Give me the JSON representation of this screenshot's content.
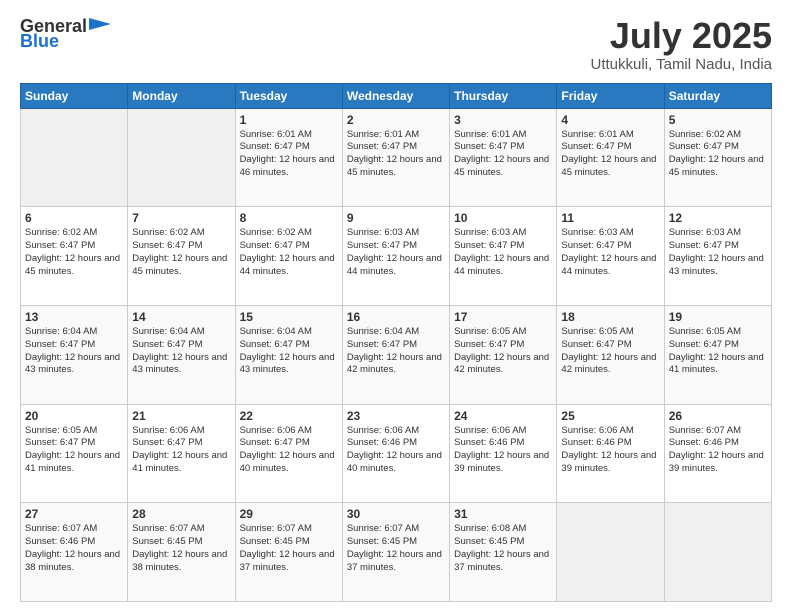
{
  "header": {
    "logo_general": "General",
    "logo_blue": "Blue",
    "month": "July 2025",
    "location": "Uttukkuli, Tamil Nadu, India"
  },
  "weekdays": [
    "Sunday",
    "Monday",
    "Tuesday",
    "Wednesday",
    "Thursday",
    "Friday",
    "Saturday"
  ],
  "weeks": [
    [
      {
        "day": "",
        "sunrise": "",
        "sunset": "",
        "daylight": "",
        "empty": true
      },
      {
        "day": "",
        "sunrise": "",
        "sunset": "",
        "daylight": "",
        "empty": true
      },
      {
        "day": "1",
        "sunrise": "Sunrise: 6:01 AM",
        "sunset": "Sunset: 6:47 PM",
        "daylight": "Daylight: 12 hours and 46 minutes."
      },
      {
        "day": "2",
        "sunrise": "Sunrise: 6:01 AM",
        "sunset": "Sunset: 6:47 PM",
        "daylight": "Daylight: 12 hours and 45 minutes."
      },
      {
        "day": "3",
        "sunrise": "Sunrise: 6:01 AM",
        "sunset": "Sunset: 6:47 PM",
        "daylight": "Daylight: 12 hours and 45 minutes."
      },
      {
        "day": "4",
        "sunrise": "Sunrise: 6:01 AM",
        "sunset": "Sunset: 6:47 PM",
        "daylight": "Daylight: 12 hours and 45 minutes."
      },
      {
        "day": "5",
        "sunrise": "Sunrise: 6:02 AM",
        "sunset": "Sunset: 6:47 PM",
        "daylight": "Daylight: 12 hours and 45 minutes."
      }
    ],
    [
      {
        "day": "6",
        "sunrise": "Sunrise: 6:02 AM",
        "sunset": "Sunset: 6:47 PM",
        "daylight": "Daylight: 12 hours and 45 minutes."
      },
      {
        "day": "7",
        "sunrise": "Sunrise: 6:02 AM",
        "sunset": "Sunset: 6:47 PM",
        "daylight": "Daylight: 12 hours and 45 minutes."
      },
      {
        "day": "8",
        "sunrise": "Sunrise: 6:02 AM",
        "sunset": "Sunset: 6:47 PM",
        "daylight": "Daylight: 12 hours and 44 minutes."
      },
      {
        "day": "9",
        "sunrise": "Sunrise: 6:03 AM",
        "sunset": "Sunset: 6:47 PM",
        "daylight": "Daylight: 12 hours and 44 minutes."
      },
      {
        "day": "10",
        "sunrise": "Sunrise: 6:03 AM",
        "sunset": "Sunset: 6:47 PM",
        "daylight": "Daylight: 12 hours and 44 minutes."
      },
      {
        "day": "11",
        "sunrise": "Sunrise: 6:03 AM",
        "sunset": "Sunset: 6:47 PM",
        "daylight": "Daylight: 12 hours and 44 minutes."
      },
      {
        "day": "12",
        "sunrise": "Sunrise: 6:03 AM",
        "sunset": "Sunset: 6:47 PM",
        "daylight": "Daylight: 12 hours and 43 minutes."
      }
    ],
    [
      {
        "day": "13",
        "sunrise": "Sunrise: 6:04 AM",
        "sunset": "Sunset: 6:47 PM",
        "daylight": "Daylight: 12 hours and 43 minutes."
      },
      {
        "day": "14",
        "sunrise": "Sunrise: 6:04 AM",
        "sunset": "Sunset: 6:47 PM",
        "daylight": "Daylight: 12 hours and 43 minutes."
      },
      {
        "day": "15",
        "sunrise": "Sunrise: 6:04 AM",
        "sunset": "Sunset: 6:47 PM",
        "daylight": "Daylight: 12 hours and 43 minutes."
      },
      {
        "day": "16",
        "sunrise": "Sunrise: 6:04 AM",
        "sunset": "Sunset: 6:47 PM",
        "daylight": "Daylight: 12 hours and 42 minutes."
      },
      {
        "day": "17",
        "sunrise": "Sunrise: 6:05 AM",
        "sunset": "Sunset: 6:47 PM",
        "daylight": "Daylight: 12 hours and 42 minutes."
      },
      {
        "day": "18",
        "sunrise": "Sunrise: 6:05 AM",
        "sunset": "Sunset: 6:47 PM",
        "daylight": "Daylight: 12 hours and 42 minutes."
      },
      {
        "day": "19",
        "sunrise": "Sunrise: 6:05 AM",
        "sunset": "Sunset: 6:47 PM",
        "daylight": "Daylight: 12 hours and 41 minutes."
      }
    ],
    [
      {
        "day": "20",
        "sunrise": "Sunrise: 6:05 AM",
        "sunset": "Sunset: 6:47 PM",
        "daylight": "Daylight: 12 hours and 41 minutes."
      },
      {
        "day": "21",
        "sunrise": "Sunrise: 6:06 AM",
        "sunset": "Sunset: 6:47 PM",
        "daylight": "Daylight: 12 hours and 41 minutes."
      },
      {
        "day": "22",
        "sunrise": "Sunrise: 6:06 AM",
        "sunset": "Sunset: 6:47 PM",
        "daylight": "Daylight: 12 hours and 40 minutes."
      },
      {
        "day": "23",
        "sunrise": "Sunrise: 6:06 AM",
        "sunset": "Sunset: 6:46 PM",
        "daylight": "Daylight: 12 hours and 40 minutes."
      },
      {
        "day": "24",
        "sunrise": "Sunrise: 6:06 AM",
        "sunset": "Sunset: 6:46 PM",
        "daylight": "Daylight: 12 hours and 39 minutes."
      },
      {
        "day": "25",
        "sunrise": "Sunrise: 6:06 AM",
        "sunset": "Sunset: 6:46 PM",
        "daylight": "Daylight: 12 hours and 39 minutes."
      },
      {
        "day": "26",
        "sunrise": "Sunrise: 6:07 AM",
        "sunset": "Sunset: 6:46 PM",
        "daylight": "Daylight: 12 hours and 39 minutes."
      }
    ],
    [
      {
        "day": "27",
        "sunrise": "Sunrise: 6:07 AM",
        "sunset": "Sunset: 6:46 PM",
        "daylight": "Daylight: 12 hours and 38 minutes."
      },
      {
        "day": "28",
        "sunrise": "Sunrise: 6:07 AM",
        "sunset": "Sunset: 6:45 PM",
        "daylight": "Daylight: 12 hours and 38 minutes."
      },
      {
        "day": "29",
        "sunrise": "Sunrise: 6:07 AM",
        "sunset": "Sunset: 6:45 PM",
        "daylight": "Daylight: 12 hours and 37 minutes."
      },
      {
        "day": "30",
        "sunrise": "Sunrise: 6:07 AM",
        "sunset": "Sunset: 6:45 PM",
        "daylight": "Daylight: 12 hours and 37 minutes."
      },
      {
        "day": "31",
        "sunrise": "Sunrise: 6:08 AM",
        "sunset": "Sunset: 6:45 PM",
        "daylight": "Daylight: 12 hours and 37 minutes."
      },
      {
        "day": "",
        "sunrise": "",
        "sunset": "",
        "daylight": "",
        "empty": true
      },
      {
        "day": "",
        "sunrise": "",
        "sunset": "",
        "daylight": "",
        "empty": true
      }
    ]
  ]
}
